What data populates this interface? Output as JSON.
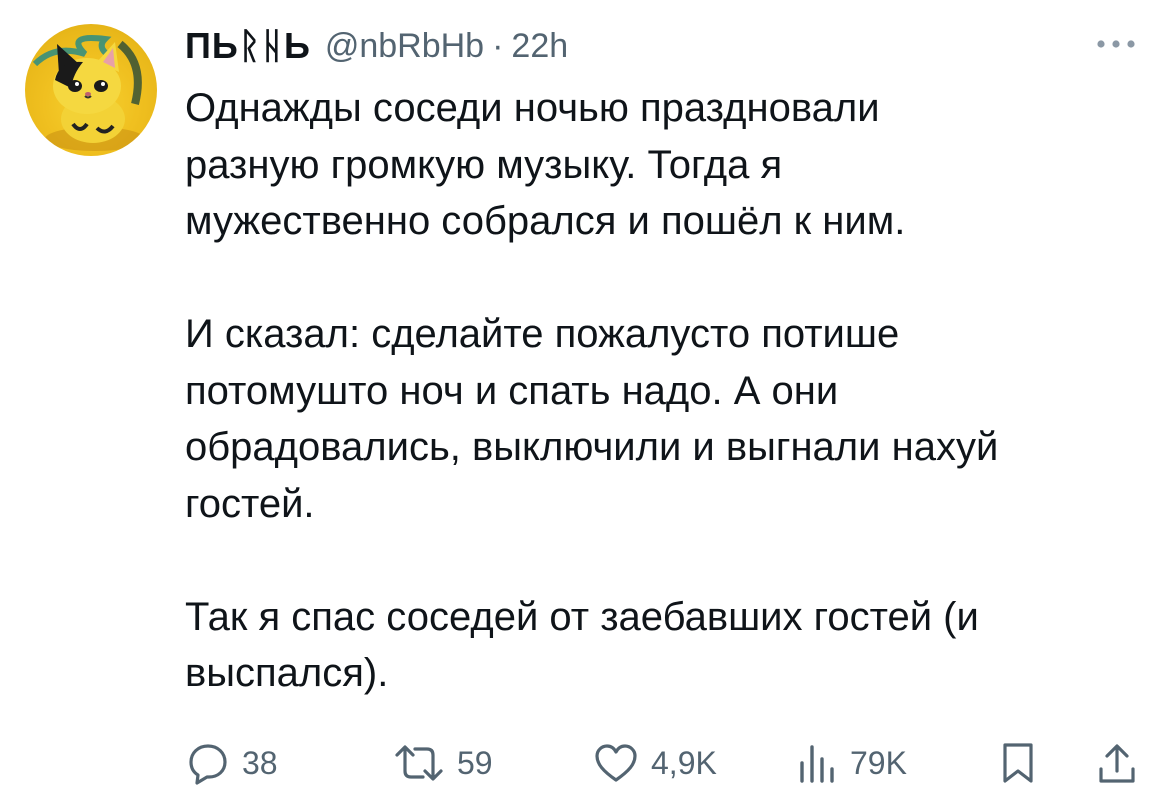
{
  "author": {
    "display_name": "ПЬᚱᚺЬ",
    "handle": "@nbRbHb",
    "separator": "·",
    "time": "22h",
    "avatar_icon": "cat-avatar-icon"
  },
  "tweet": {
    "paragraphs": [
      "Однажды соседи ночью праздновали разную громкую музыку. Тогда я мужественно собрался и пошёл к ним.",
      "И сказал: сделайте пожалусто потише потомушто ноч и спать надо. А они обрадовались, выключили и выгнали нахуй гостей.",
      "Так я спас соседей от заебавших гостей (и выспался)."
    ],
    "lines": [
      "Однажды соседи ночью праздновали",
      "разную громкую музыку. Тогда я",
      "мужественно собрался и пошёл к ним.",
      "",
      "И сказал: сделайте пожалусто потише",
      "потомушто ноч и спать надо. А они",
      "обрадовались, выключили и выгнали нахуй",
      "гостей.",
      "",
      "Так я спас соседей от заебавших гостей (и",
      "выспался)."
    ]
  },
  "actions": {
    "replies": "38",
    "retweets": "59",
    "likes": "4,9K",
    "views": "79K",
    "icons": [
      "reply-icon",
      "retweet-icon",
      "like-icon",
      "views-icon",
      "bookmark-icon",
      "share-icon"
    ]
  },
  "colors": {
    "text": "#0f1419",
    "secondary": "#536471"
  }
}
